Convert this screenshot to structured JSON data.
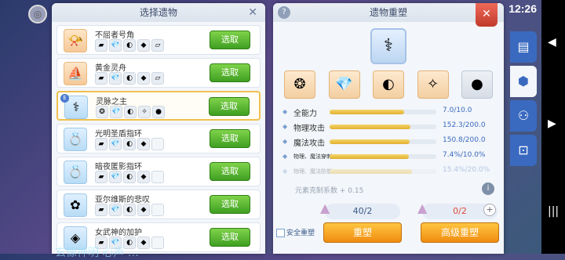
{
  "status": {
    "time": "12:26",
    "icons": "▼◢▮"
  },
  "left_panel": {
    "title": "选择遗物",
    "close": "✕",
    "items": [
      {
        "name": "不屈者号角",
        "icon": "📯",
        "style": "",
        "mats": [
          "▰",
          "💎",
          "◐",
          "◆",
          "▱"
        ],
        "button": "选取"
      },
      {
        "name": "黄金灵舟",
        "icon": "⛵",
        "style": "",
        "mats": [
          "▰",
          "💎",
          "◐",
          "◆",
          "▱"
        ],
        "button": "选取"
      },
      {
        "name": "灵脉之主",
        "icon": "⚕",
        "style": "blue",
        "selected": true,
        "mats": [
          "❂",
          "💎",
          "◐",
          "✧",
          "●"
        ],
        "button": "选取"
      },
      {
        "name": "光明圣盾指环",
        "icon": "💍",
        "style": "blue",
        "mats": [
          "▰",
          "💎",
          "◐",
          "◆",
          ""
        ],
        "button": "选取"
      },
      {
        "name": "暗夜匿影指环",
        "icon": "💍",
        "style": "blue",
        "mats": [
          "▰",
          "💎",
          "◐",
          "◆",
          ""
        ],
        "button": "选取"
      },
      {
        "name": "亚尔维斯的悲叹",
        "icon": "✿",
        "style": "blue",
        "mats": [
          "▰",
          "💎",
          "◐",
          "◆",
          ""
        ],
        "button": "选取"
      },
      {
        "name": "女武神的加护",
        "icon": "◈",
        "style": "blue",
        "mats": [
          "▰",
          "💎",
          "◐",
          "◆",
          ""
        ],
        "button": "选取"
      }
    ]
  },
  "right_panel": {
    "title": "遗物重塑",
    "help": "?",
    "close": "✕",
    "center_icon": "⚕",
    "materials": [
      "❂",
      "💎",
      "◐",
      "✧",
      "●"
    ],
    "stats": [
      {
        "label": "全能力",
        "value": "7.0/10.0",
        "fill": 0.7,
        "small": false,
        "faded": false
      },
      {
        "label": "物理攻击",
        "value": "152.3/200.0",
        "fill": 0.76,
        "small": false,
        "faded": false
      },
      {
        "label": "魔法攻击",
        "value": "150.8/200.0",
        "fill": 0.75,
        "small": false,
        "faded": false
      },
      {
        "label": "物理、魔法穿刺",
        "value": "7.4%/10.0%",
        "fill": 0.74,
        "small": true,
        "faded": false
      },
      {
        "label": "物理、魔法防御",
        "value": "15.4%/20.0%",
        "fill": 0.77,
        "small": true,
        "faded": true
      }
    ],
    "element_text": "元素克制系数 + 0.15",
    "info": "i",
    "counter1": "40/2",
    "counter2": "0/2",
    "plus": "+",
    "safe_label": "安全重塑",
    "reshape_button": "重塑",
    "advanced_button": "高级重塑"
  },
  "side_tabs": [
    "▤",
    "⬢",
    "⚇",
    "⊡"
  ],
  "nav": {
    "back": "◀",
    "forward": "▶",
    "menu": "|||"
  },
  "bottom_banner": "玄像神明 心声 …"
}
